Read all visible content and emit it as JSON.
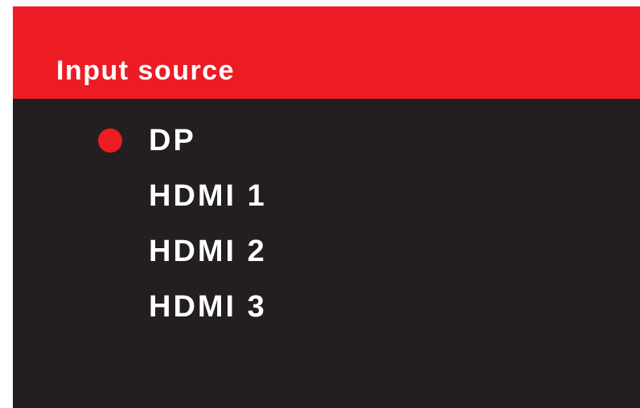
{
  "header": {
    "title": "Input source"
  },
  "sources": [
    {
      "label": "DP",
      "selected": true
    },
    {
      "label": "HDMI 1",
      "selected": false
    },
    {
      "label": "HDMI 2",
      "selected": false
    },
    {
      "label": "HDMI 3",
      "selected": false
    }
  ],
  "colors": {
    "accent": "#ed1c24",
    "background": "#231f20",
    "text": "#ffffff"
  },
  "icons": {
    "selection_indicator": "selected-dot-icon"
  }
}
